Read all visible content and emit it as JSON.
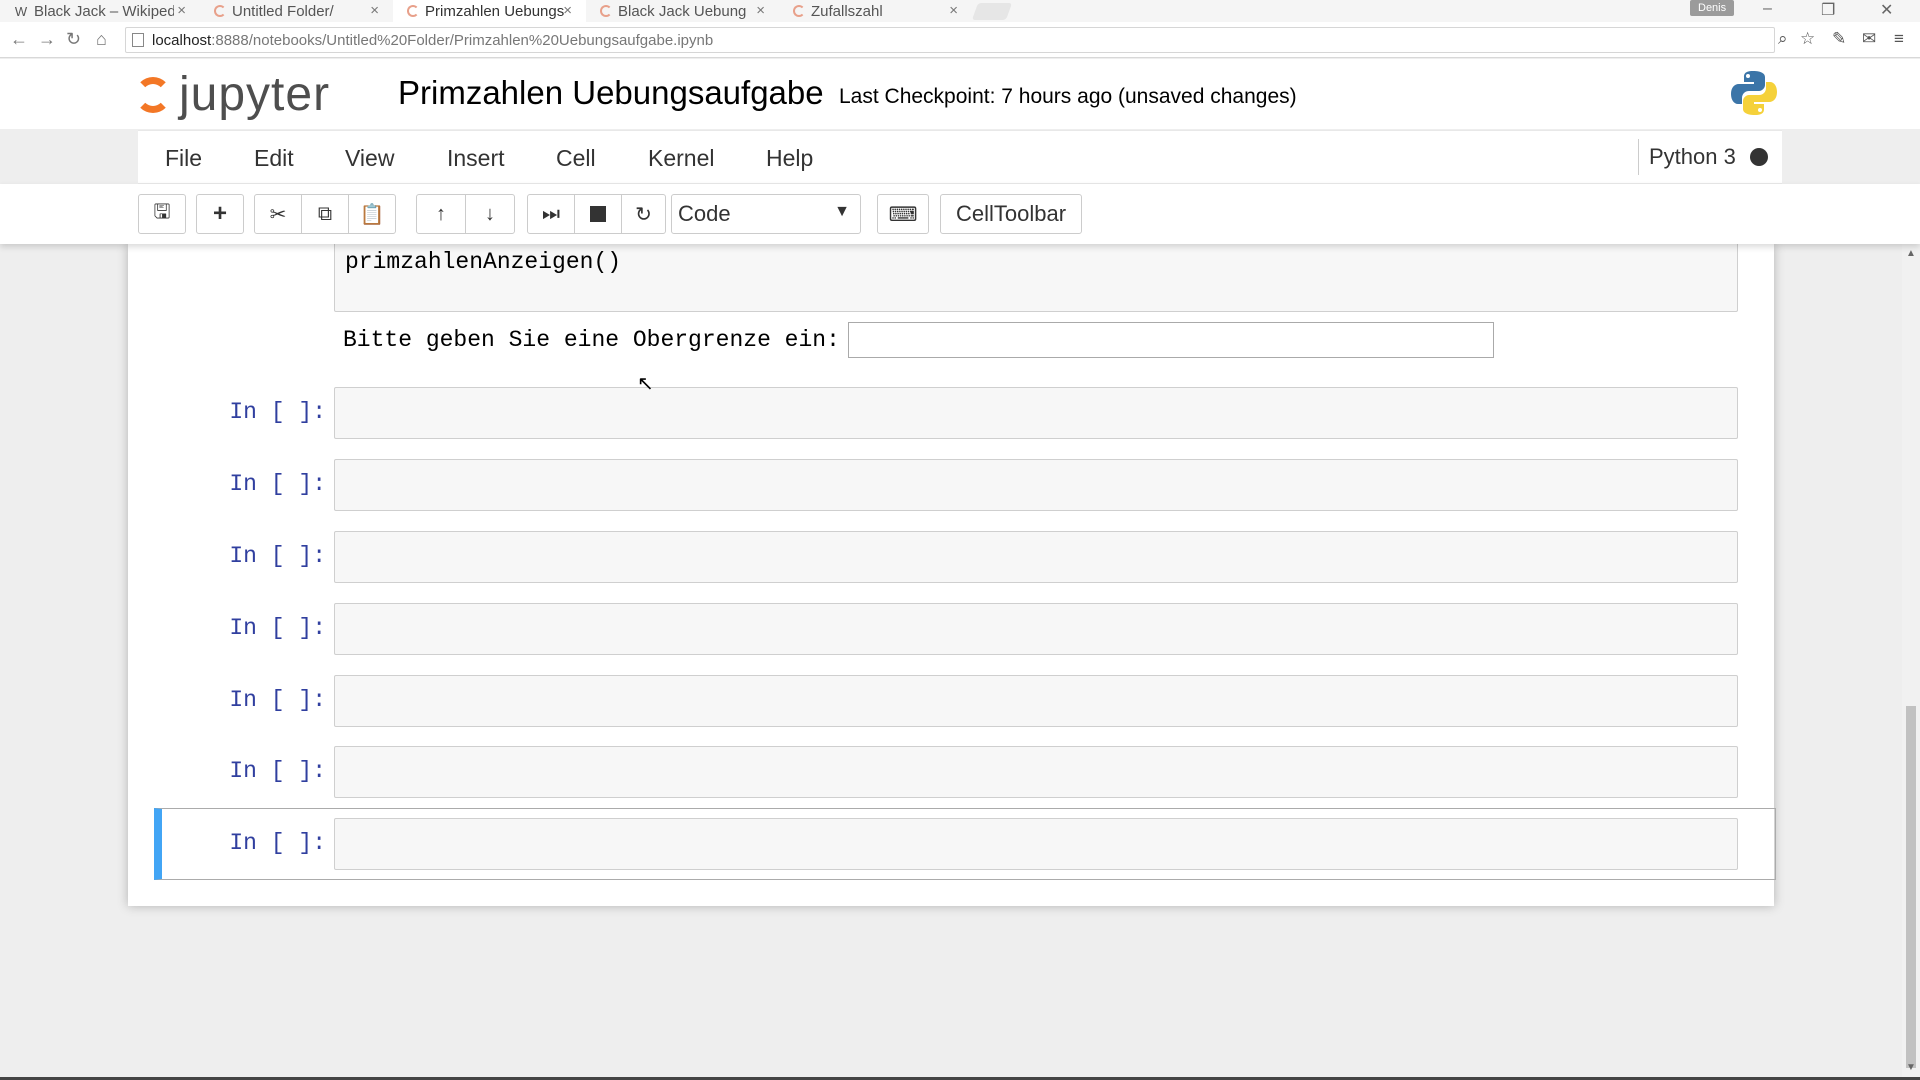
{
  "browser": {
    "tabs": [
      {
        "label": "Black Jack – Wikipedia",
        "favicon": "W"
      },
      {
        "label": "Untitled Folder/",
        "favicon": "jupyter-loading"
      },
      {
        "label": "Primzahlen Uebungs",
        "favicon": "jupyter-loading"
      },
      {
        "label": "Black Jack Uebung",
        "favicon": "jupyter-loading"
      },
      {
        "label": "Zufallszahl",
        "favicon": "jupyter-loading"
      }
    ],
    "tab_close": "×",
    "profile": "Denis",
    "url_host": "localhost",
    "url_path": ":8888/notebooks/Untitled%20Folder/Primzahlen%20Uebungsaufgabe.ipynb"
  },
  "header": {
    "logo_text": "jupyter",
    "notebook_name": "Primzahlen Uebungsaufgabe",
    "checkpoint": "Last Checkpoint: 7 hours ago (unsaved changes)"
  },
  "menu": {
    "items": [
      "File",
      "Edit",
      "View",
      "Insert",
      "Cell",
      "Kernel",
      "Help"
    ],
    "kernel_name": "Python 3"
  },
  "toolbar": {
    "cell_type": "Code",
    "celltoolbar_label": "CellToolbar",
    "icons": [
      "save-icon",
      "plus-icon",
      "scissors-icon",
      "copy-icon",
      "paste-icon",
      "arrow-up-icon",
      "arrow-down-icon",
      "step-forward-icon",
      "stop-icon",
      "refresh-icon",
      "keyboard-icon"
    ]
  },
  "notebook": {
    "code_line": "primzahlenAnzeigen()",
    "output_prompt": "Bitte geben Sie eine Obergrenze ein:",
    "output_value": "",
    "cell_prompts": [
      "In [ ]:",
      "In [ ]:",
      "In [ ]:",
      "In [ ]:",
      "In [ ]:",
      "In [ ]:",
      "In [ ]:"
    ]
  },
  "colors": {
    "jupyter_orange": "#f37726",
    "prompt_blue": "#303f9f",
    "selected_cell": "#42a5f5"
  }
}
